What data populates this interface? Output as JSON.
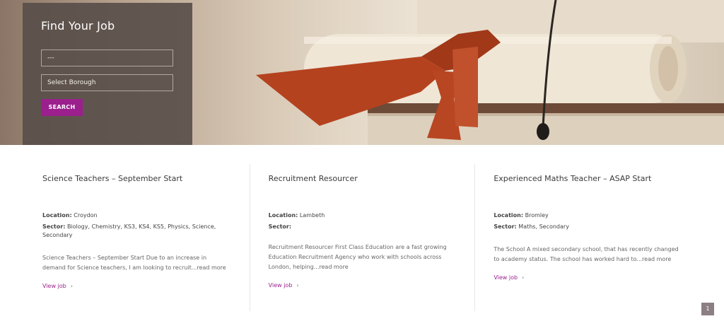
{
  "search": {
    "title": "Find Your Job",
    "keyword_value": "---",
    "borough_value": "Select Borough",
    "button_label": "SEARCH"
  },
  "jobs": [
    {
      "title": "Science Teachers – September Start",
      "location_label": "Location:",
      "location": "Croydon",
      "sector_label": "Sector:",
      "sector": "Biology, Chemistry, KS3, KS4, KS5, Physics, Science, Secondary",
      "excerpt": "Science Teachers – September Start Due to an increase in demand for Science teachers, I am looking to recruit...read more",
      "link": "View job"
    },
    {
      "title": "Recruitment Resourcer",
      "location_label": "Location:",
      "location": "Lambeth",
      "sector_label": "Sector:",
      "sector": "",
      "excerpt": "Recruitment Resourcer First Class Education are a fast growing Education Recruitment Agency who work with schools across London, helping...read more",
      "link": "View job"
    },
    {
      "title": "Experienced Maths Teacher – ASAP Start",
      "location_label": "Location:",
      "location": "Bromley",
      "sector_label": "Sector:",
      "sector": "Maths, Secondary",
      "excerpt": "The School A mixed secondary school, that has recently changed to academy status. The school has worked hard to...read more",
      "link": "View job"
    }
  ],
  "pagination": {
    "current": "1"
  },
  "colors": {
    "accent": "#9b1f8d",
    "panel": "#584e48",
    "ribbon": "#b5421e"
  },
  "icons": {
    "link_chevron": "chevron-right-icon"
  }
}
